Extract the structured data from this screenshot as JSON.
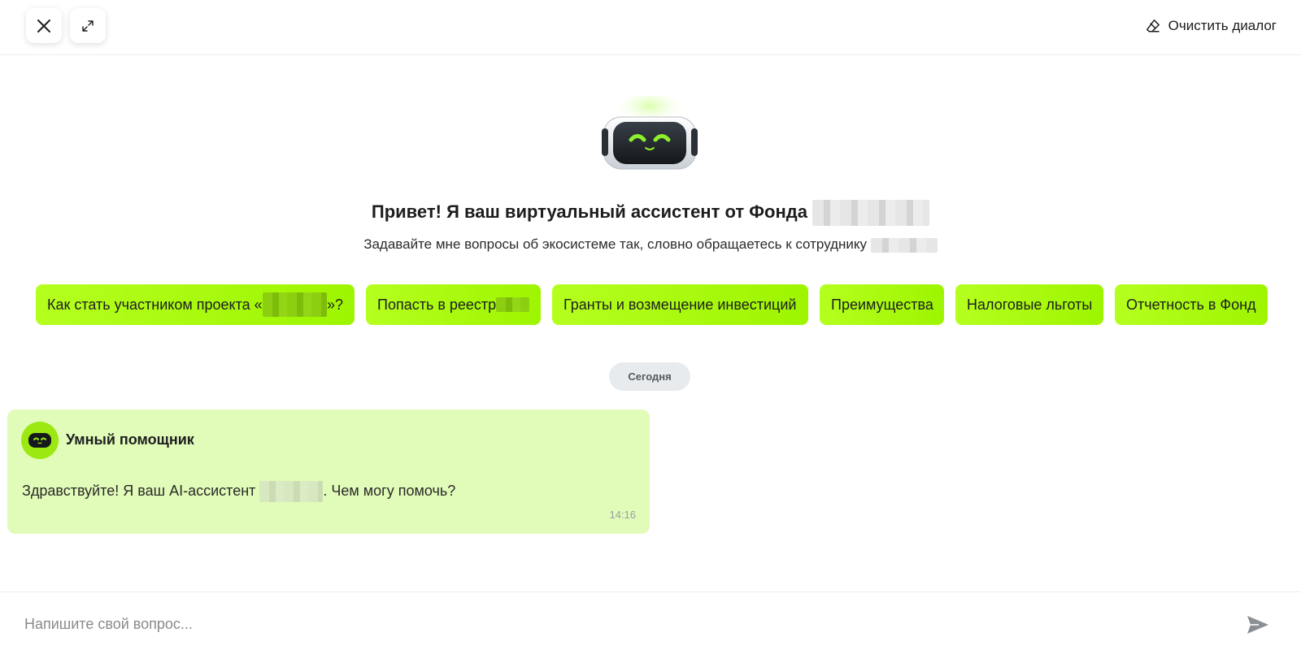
{
  "header": {
    "close_icon": "close-icon",
    "expand_icon": "expand-icon",
    "clear_label": "Очистить диалог",
    "clear_icon": "eraser-icon"
  },
  "intro": {
    "title": "Привет! Я ваш виртуальный ассистент от Фонда",
    "subtitle": "Задавайте мне вопросы об экосистеме так, словно обращаетесь к сотруднику"
  },
  "chips": [
    {
      "label_before": "Как стать участником проекта «",
      "label_after": "»?"
    },
    {
      "label_before": "Попасть в реестр",
      "label_after": ""
    },
    {
      "label_before": "Гранты и возмещение инвестиций",
      "label_after": ""
    },
    {
      "label_before": "Преимущества",
      "label_after": ""
    },
    {
      "label_before": "Налоговые льготы",
      "label_after": ""
    },
    {
      "label_before": "Отчетность в Фонд",
      "label_after": ""
    }
  ],
  "chat": {
    "date_label": "Сегодня",
    "messages": [
      {
        "author": "Умный помощник",
        "text_before": "Здравствуйте! Я ваш AI-ассистент ",
        "text_after": ". Чем могу помочь?",
        "time": "14:16"
      }
    ]
  },
  "composer": {
    "placeholder": "Напишите свой вопрос...",
    "value": "",
    "send_icon": "send-icon"
  },
  "colors": {
    "accent": "#a6fa0a",
    "message_bg": "#e1fbb8",
    "date_pill_bg": "#e8ebee"
  }
}
